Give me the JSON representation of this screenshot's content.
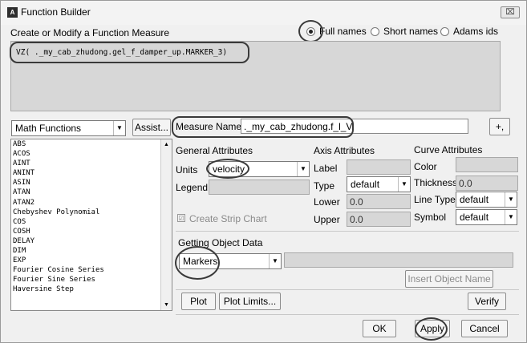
{
  "window": {
    "title": "Function Builder",
    "app_icon": "A",
    "close_glyph": "⌧"
  },
  "header": {
    "label": "Create or Modify a Function Measure"
  },
  "name_mode": {
    "options": [
      "Full names",
      "Short names",
      "Adams ids"
    ],
    "selected": "Full names"
  },
  "function_text": "VZ( ._my_cab_zhudong.gel_f_damper_up.MARKER_3)",
  "function_category": {
    "value": "Math Functions",
    "assist_label": "Assist..."
  },
  "function_list": [
    "ABS",
    "ACOS",
    "AINT",
    "ANINT",
    "ASIN",
    "ATAN",
    "ATAN2",
    "Chebyshev Polynomial",
    "COS",
    "COSH",
    "DELAY",
    "DIM",
    "EXP",
    "Fourier Cosine Series",
    "Fourier Sine Series",
    "Haversine Step"
  ],
  "measure": {
    "label": "Measure Name",
    "value": "._my_cab_zhudong.f_l_V",
    "more_label": "+,"
  },
  "general": {
    "heading": "General Attributes",
    "units_label": "Units",
    "units_value": "velocity",
    "legend_label": "Legend",
    "legend_value": "",
    "strip_chart_label": "Create Strip Chart"
  },
  "axis": {
    "heading": "Axis Attributes",
    "label_label": "Label",
    "label_value": "",
    "type_label": "Type",
    "type_value": "default",
    "lower_label": "Lower",
    "lower_value": "0.0",
    "upper_label": "Upper",
    "upper_value": "0.0"
  },
  "curve": {
    "heading": "Curve Attributes",
    "color_label": "Color",
    "color_value": "",
    "thickness_label": "Thickness",
    "thickness_value": "0.0",
    "linetype_label": "Line Type",
    "linetype_value": "default",
    "symbol_label": "Symbol",
    "symbol_value": "default"
  },
  "object_data": {
    "heading": "Getting Object Data",
    "type_value": "Markers",
    "entry_value": "",
    "insert_label": "Insert Object Name"
  },
  "buttons": {
    "plot": "Plot",
    "plot_limits": "Plot Limits...",
    "verify": "Verify",
    "ok": "OK",
    "apply": "Apply",
    "cancel": "Cancel"
  },
  "glyphs": {
    "dropdown": "▼",
    "scroll_up": "▲",
    "scroll_down": "▼",
    "check": "☑"
  }
}
